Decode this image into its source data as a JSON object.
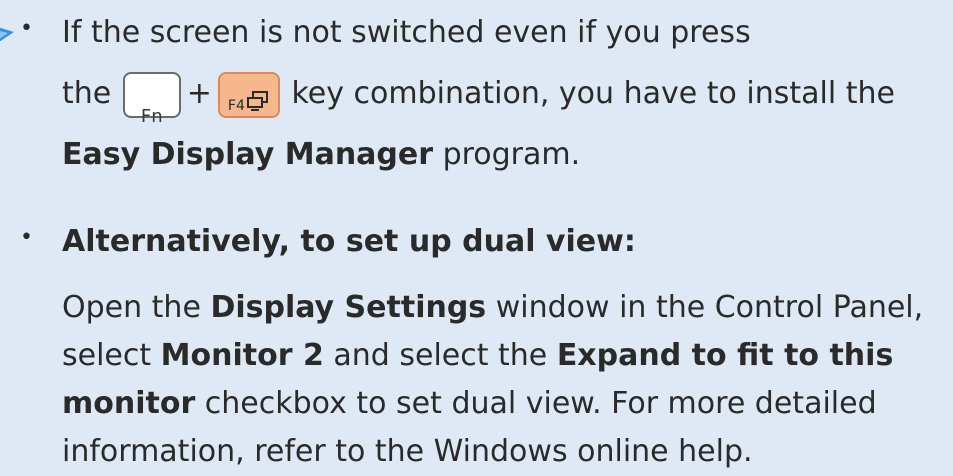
{
  "bullet1": {
    "line1": "If the screen is not switched even if you press",
    "line2_pre": "the",
    "key_fn": "Fn",
    "plus": "+",
    "key_f4": "F4",
    "line2_post": "key combination, you have to install the",
    "line3_bold": "Easy Display Manager",
    "line3_post": " program."
  },
  "bullet2": {
    "heading": "Alternatively, to set up dual view:",
    "p1_pre": "Open the ",
    "p1_bold": "Display Settings",
    "p1_post": " window in the Control Panel,",
    "p2_pre": "select ",
    "p2_bold1": "Monitor 2",
    "p2_mid": " and select the ",
    "p2_bold2": "Expand to fit to this",
    "p3_bold": "monitor",
    "p3_post": " checkbox to set dual view. For more detailed",
    "p4": "information, refer to the Windows online help."
  },
  "icons": {
    "note": "note-icon",
    "display_switch": "display-switch-icon"
  },
  "colors": {
    "background": "#dfe9f5",
    "f4_key": "#f6b78e",
    "icon_blue": "#3b8fd6"
  }
}
